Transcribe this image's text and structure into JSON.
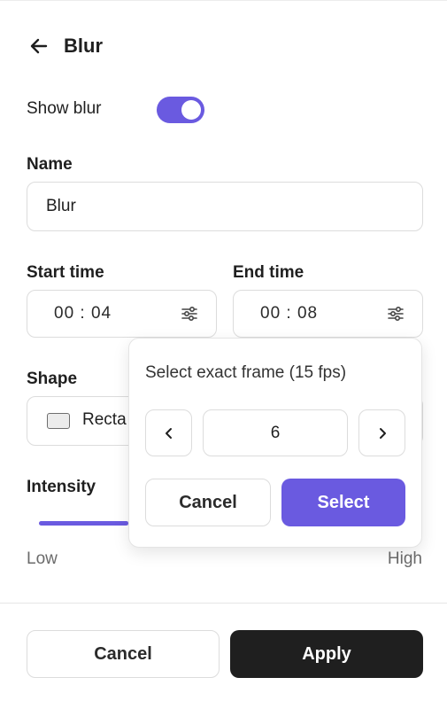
{
  "header": {
    "title": "Blur",
    "back_icon": "arrow-left-icon"
  },
  "show_blur": {
    "label": "Show blur",
    "enabled": true
  },
  "name": {
    "label": "Name",
    "value": "Blur"
  },
  "start_time": {
    "label": "Start time",
    "value": "00 : 04",
    "icon": "sliders-icon"
  },
  "end_time": {
    "label": "End time",
    "value": "00 : 08",
    "icon": "sliders-icon"
  },
  "shape": {
    "label": "Shape",
    "value": "Recta",
    "swatch_icon": "rectangle-icon"
  },
  "intensity": {
    "label": "Intensity",
    "level": 0.24,
    "low_label": "Low",
    "high_label": "High"
  },
  "frame_picker": {
    "title": "Select exact frame (15 fps)",
    "value": "6",
    "prev_icon": "chevron-left-icon",
    "next_icon": "chevron-right-icon",
    "cancel_label": "Cancel",
    "select_label": "Select"
  },
  "footer": {
    "cancel_label": "Cancel",
    "apply_label": "Apply"
  },
  "colors": {
    "accent": "#6a5ae0",
    "dark": "#1f1f1f",
    "border": "#dcdcdc"
  }
}
